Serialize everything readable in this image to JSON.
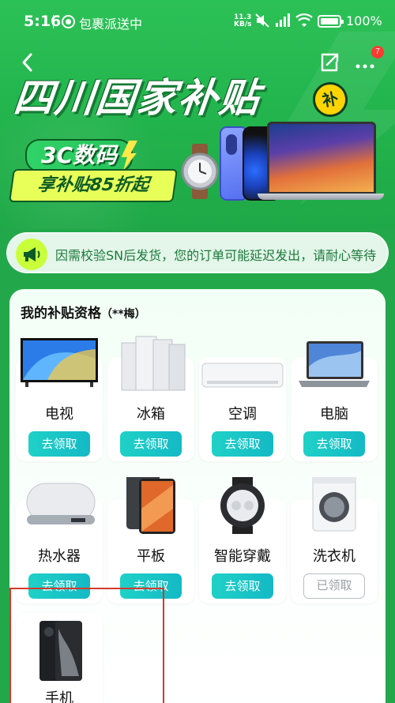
{
  "status": {
    "time": "5:16",
    "notification": "包裹派送中",
    "speed_top": "11.3",
    "speed_bottom": "KB/s",
    "battery_percent": "100%"
  },
  "nav": {
    "badge_count": "7"
  },
  "banner": {
    "title": "四川国家补贴",
    "badge": "补",
    "tag": "3C数码",
    "offer": "享补贴85折起"
  },
  "notice": {
    "text": "因需校验SN后发货，您的订单可能延迟发出，请耐心等待"
  },
  "card": {
    "title": "我的补贴资格",
    "user": "（**梅）",
    "items": [
      {
        "label": "电视",
        "button": "去领取",
        "icon": "tv-icon"
      },
      {
        "label": "冰箱",
        "button": "去领取",
        "icon": "fridge-icon"
      },
      {
        "label": "空调",
        "button": "去领取",
        "icon": "air-conditioner-icon"
      },
      {
        "label": "电脑",
        "button": "去领取",
        "icon": "laptop-icon"
      },
      {
        "label": "热水器",
        "button": "去领取",
        "icon": "water-heater-icon"
      },
      {
        "label": "平板",
        "button": "去领取",
        "icon": "tablet-icon"
      },
      {
        "label": "智能穿戴",
        "button": "去领取",
        "icon": "smartwatch-icon"
      },
      {
        "label": "洗衣机",
        "button": "已领取",
        "icon": "washing-machine-icon"
      },
      {
        "label": "手机",
        "icon": "phone-icon"
      }
    ]
  },
  "colors": {
    "primary_green": "#22b34c",
    "button_teal": "#14b9c5",
    "annotation_red": "#d33a2c"
  }
}
